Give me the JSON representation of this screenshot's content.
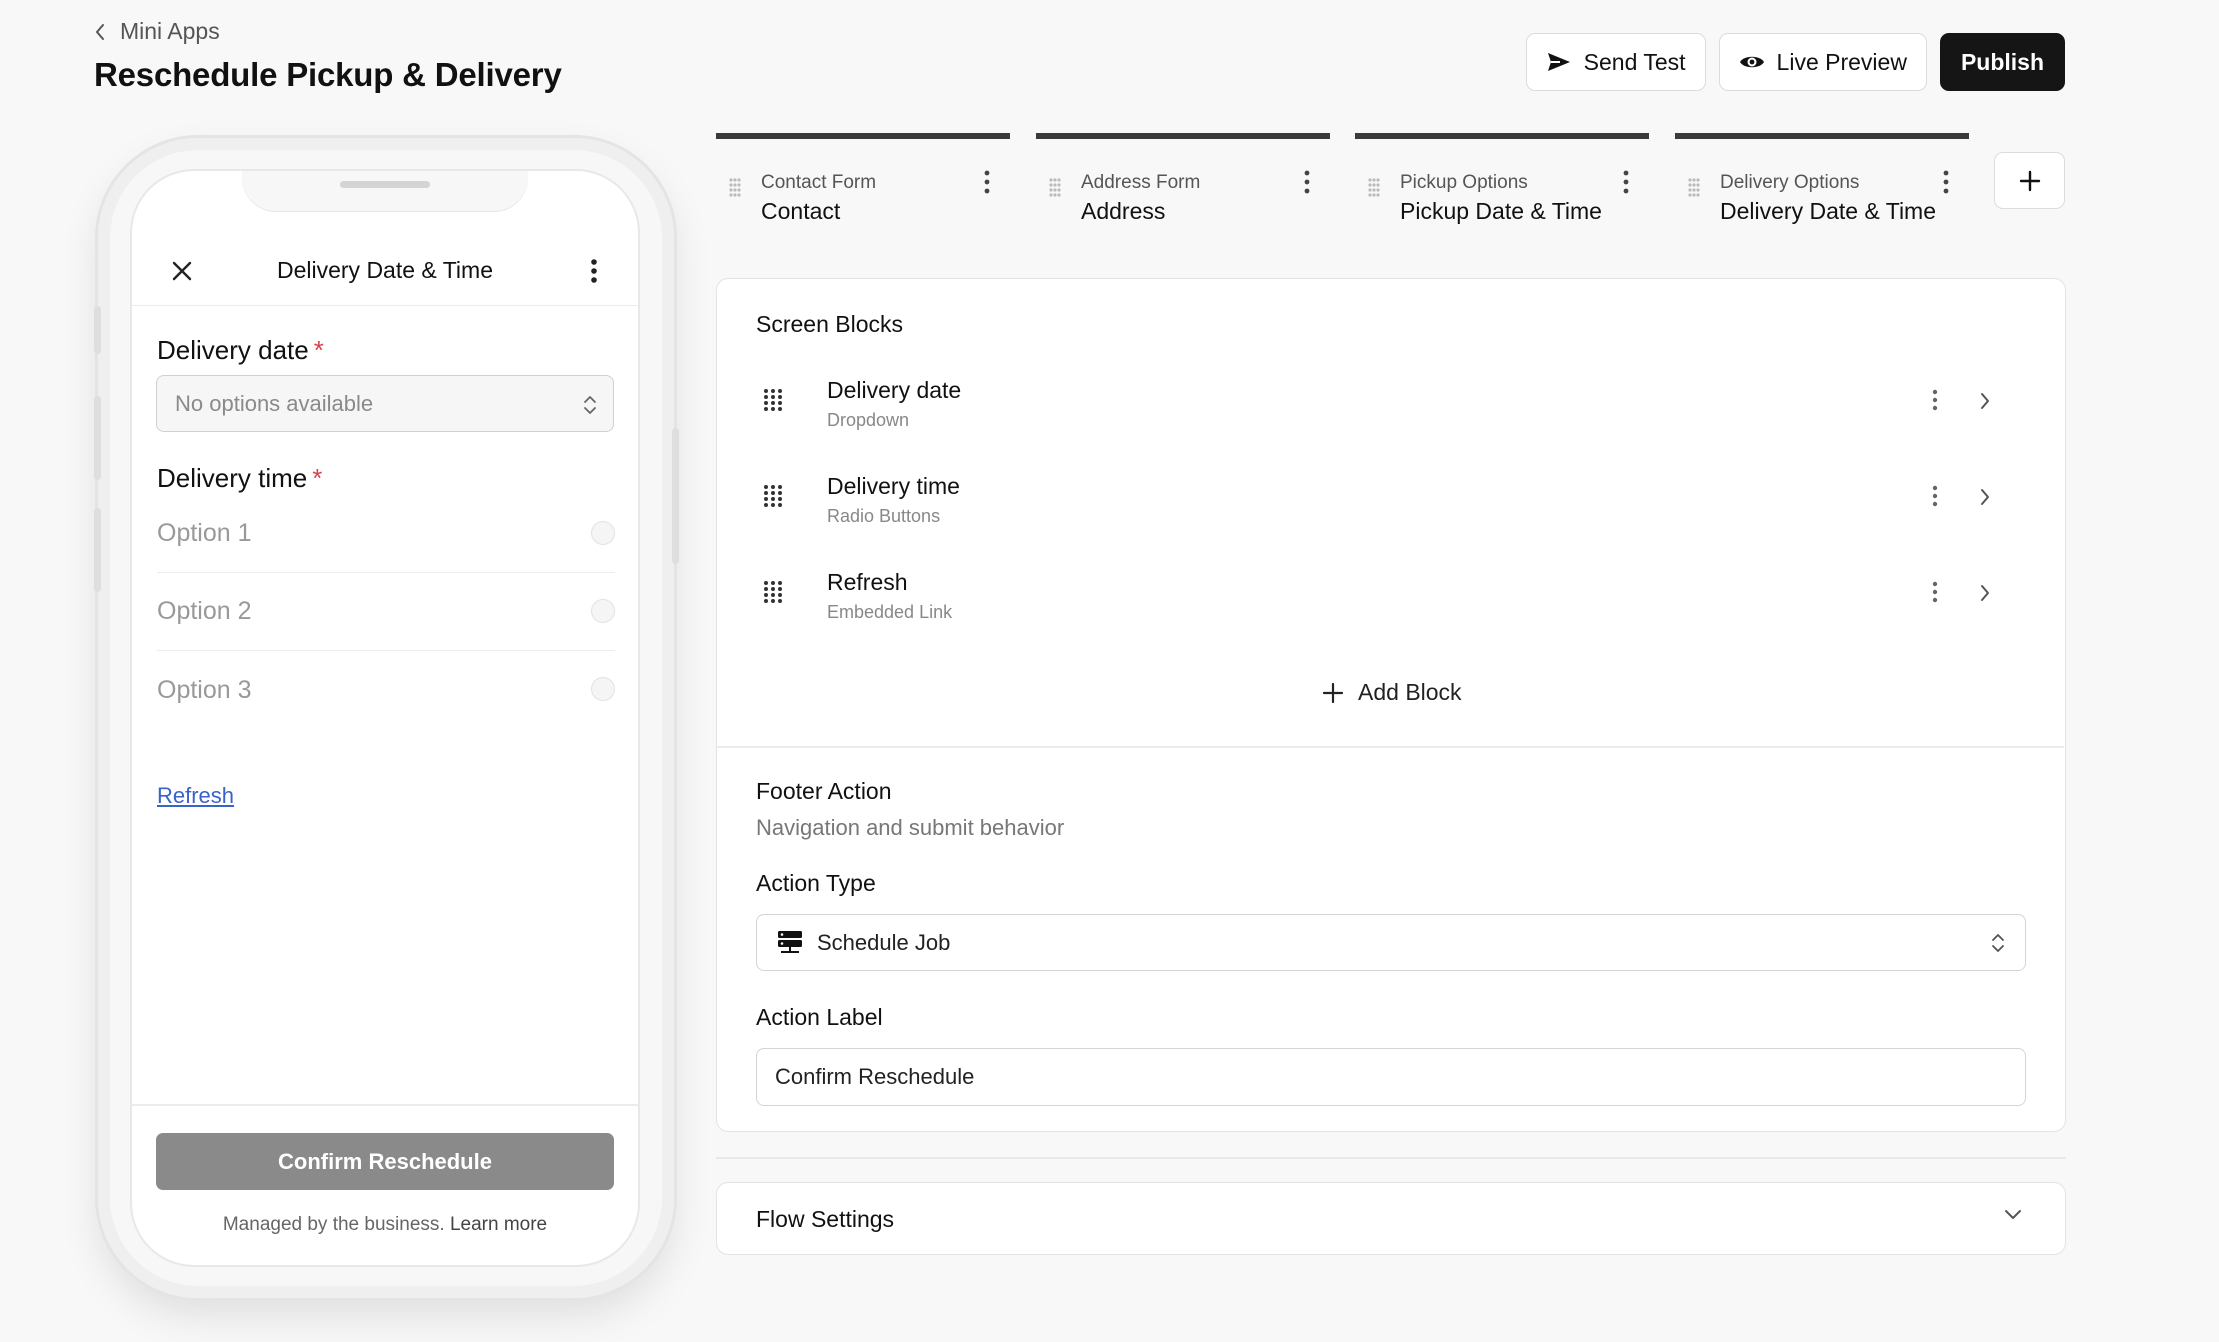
{
  "header": {
    "breadcrumb": "Mini Apps",
    "title": "Reschedule Pickup & Delivery",
    "send_test": "Send Test",
    "live_preview": "Live Preview",
    "publish": "Publish"
  },
  "phone": {
    "title": "Delivery Date & Time",
    "date_label": "Delivery date",
    "required_mark": "*",
    "date_placeholder": "No options available",
    "time_label": "Delivery time",
    "options": [
      "Option 1",
      "Option 2",
      "Option 3"
    ],
    "link": "Refresh",
    "confirm": "Confirm Reschedule",
    "managed": "Managed by the business.",
    "learn_more": "Learn more"
  },
  "tabs": [
    {
      "sub": "Contact Form",
      "name": "Contact"
    },
    {
      "sub": "Address Form",
      "name": "Address"
    },
    {
      "sub": "Pickup Options",
      "name": "Pickup Date & Time"
    },
    {
      "sub": "Delivery Options",
      "name": "Delivery Date & Time"
    }
  ],
  "blocks": {
    "heading": "Screen Blocks",
    "items": [
      {
        "name": "Delivery date",
        "type": "Dropdown"
      },
      {
        "name": "Delivery time",
        "type": "Radio Buttons"
      },
      {
        "name": "Refresh",
        "type": "Embedded Link"
      }
    ],
    "add": "Add Block"
  },
  "footer_action": {
    "heading": "Footer Action",
    "subtitle": "Navigation and submit behavior",
    "action_type_label": "Action Type",
    "action_type_value": "Schedule Job",
    "action_label_label": "Action Label",
    "action_label_value": "Confirm Reschedule"
  },
  "flow_settings": "Flow Settings",
  "icons": {
    "back": "chevron-left-icon",
    "send": "send-icon",
    "eye": "eye-icon",
    "close": "close-icon",
    "more": "more-vertical-icon",
    "drag": "drag-handle-icon",
    "plus": "plus-icon",
    "chevron_right": "chevron-right-icon",
    "chevron_down": "chevron-down-icon",
    "updown": "chevron-up-down-icon",
    "server": "server-icon"
  },
  "colors": {
    "primary": "#151515",
    "link": "#3a63c9",
    "required": "#d9414a",
    "disabled_button": "#8a8a8a"
  }
}
